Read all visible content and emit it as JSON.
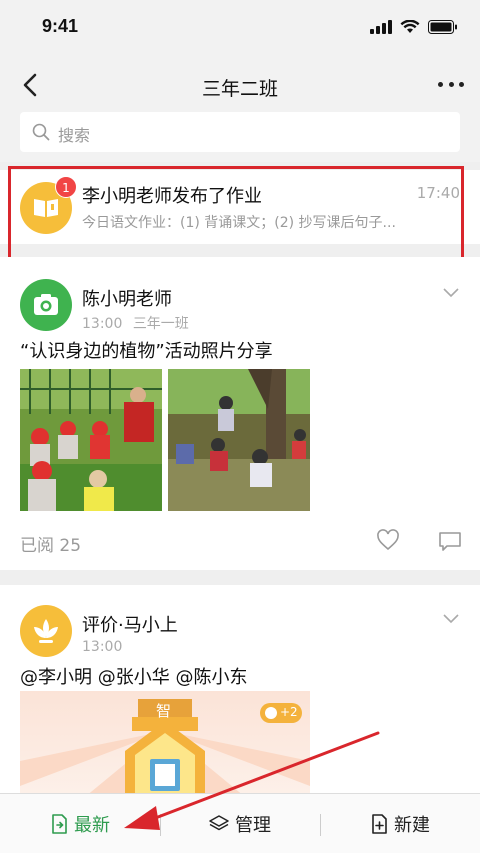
{
  "status_bar": {
    "time": "9:41"
  },
  "nav": {
    "title": "三年二班"
  },
  "search": {
    "placeholder": "搜索"
  },
  "homework": {
    "badge": "1",
    "title": "李小明老师发布了作业",
    "time": "17:40",
    "preview": "今日语文作业：(1) 背诵课文；(2) 抄写课后句子..."
  },
  "photo_post": {
    "poster": "陈小明老师",
    "time": "13:00",
    "class": "三年一班",
    "text": "“认识身边的植物”活动照片分享",
    "read_count": "已阅 25"
  },
  "eval_post": {
    "poster": "评价·马小上",
    "time": "13:00",
    "mentions": "@李小明 @张小华 @陈小东",
    "badge_char": "智",
    "badge_count": "+2"
  },
  "tabs": {
    "latest": "最新",
    "manage": "管理",
    "create": "新建"
  },
  "colors": {
    "accent_green": "#2e9b4e",
    "badge_red": "#f14545",
    "avatar_yellow": "#f6be3a",
    "avatar_green": "#3fb34f",
    "annotation_red": "#d9262c"
  }
}
